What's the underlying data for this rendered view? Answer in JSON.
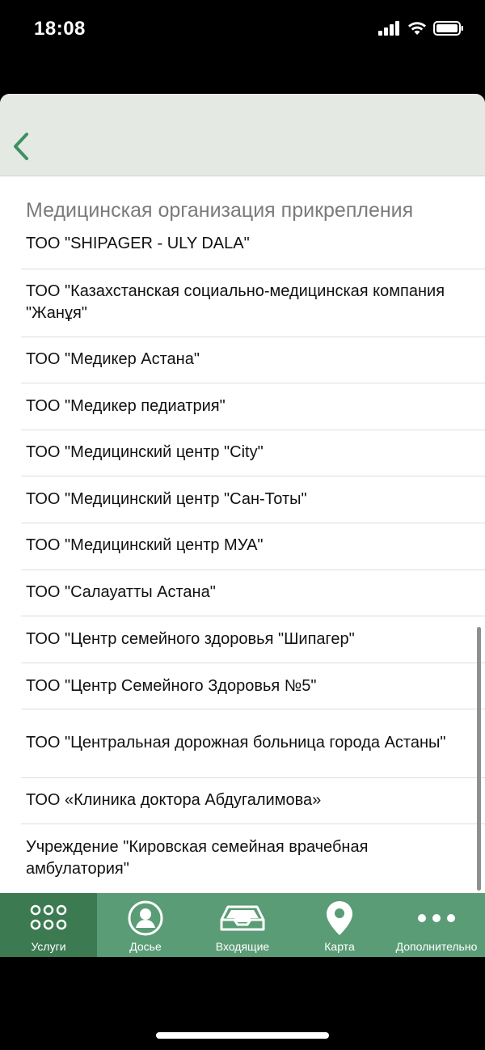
{
  "status_bar": {
    "time": "18:08"
  },
  "nav": {
    "back_icon": "chevron-left-icon"
  },
  "colors": {
    "accent": "#3f8f63",
    "tab_bar": "#5a9c75",
    "tab_active": "#3c7a52",
    "nav_bg": "#e4e9e3"
  },
  "section": {
    "title": "Медицинская организация прикрепления"
  },
  "organizations": [
    "ТОО \"SHIPAGER - ULY DALA\"",
    "ТОО \"Казахстанская социально-медицинская компания \"Жанұя\"",
    "ТОО \"Медикер Астана\"",
    "ТОО \"Медикер педиатрия\"",
    "ТОО \"Медицинский центр \"City\"",
    "ТОО \"Медицинский центр \"Сан-Тоты\"",
    "ТОО \"Медицинский центр МУА\"",
    "ТОО \"Салауатты Астана\"",
    "ТОО \"Центр семейного здоровья \"Шипагер\"",
    "ТОО \"Центр Семейного Здоровья №5\"",
    "ТОО \"Центральная дорожная больница города Астаны\"",
    "ТОО «Клиника доктора Абдугалимова»",
    "Учреждение \"Кировская семейная врачебная амбулатория\""
  ],
  "tabs": [
    {
      "label": "Услуги",
      "icon": "grid-dots-icon",
      "active": true
    },
    {
      "label": "Досье",
      "icon": "user-circle-icon",
      "active": false
    },
    {
      "label": "Входящие",
      "icon": "inbox-tray-icon",
      "active": false
    },
    {
      "label": "Карта",
      "icon": "map-pin-icon",
      "active": false
    },
    {
      "label": "Дополнительно",
      "icon": "more-dots-icon",
      "active": false
    }
  ]
}
